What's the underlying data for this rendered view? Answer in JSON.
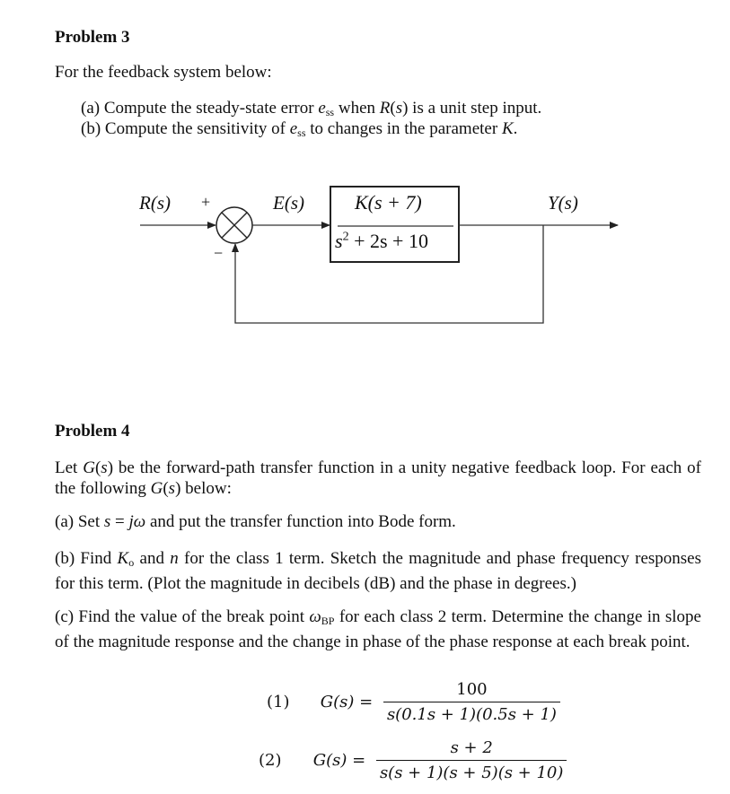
{
  "problem3": {
    "heading": "Problem 3",
    "intro": "For the feedback system below:",
    "parts": [
      {
        "label": "(a)",
        "pre": "Compute the steady-state error ",
        "var": "e",
        "sub": "ss",
        "mid": " when ",
        "var2": "R",
        "post2": "(",
        "var3": "s",
        "post": ") is a unit step input."
      },
      {
        "label": "(b)",
        "pre": "Compute the sensitivity of ",
        "var": "e",
        "sub": "ss",
        "post": " to changes in the parameter ",
        "var2": "K",
        "end": "."
      }
    ],
    "diagram": {
      "input_label": "R(s)",
      "plus_sign": "+",
      "minus_sign": "−",
      "error_label": "E(s)",
      "output_label": "Y(s)",
      "block": {
        "numerator": "K(s + 7)",
        "denominator_base": "s",
        "denominator_exp": "2",
        "denominator_rest": " + 2s + 10"
      }
    }
  },
  "problem4": {
    "heading": "Problem 4",
    "intro_1": "Let ",
    "intro_G": "G",
    "intro_s": "s",
    "intro_2": ") be the forward-path transfer function in a unity negative feedback loop.  For each of the following ",
    "intro_3": ") below:",
    "part_a_pre": "(a) Set ",
    "part_a_s": "s",
    "part_a_eq": " = ",
    "part_a_jw": "jω",
    "part_a_post": " and put the transfer function into Bode form.",
    "part_b_pre": "(b) Find ",
    "part_b_K": "K",
    "part_b_Ksub": "o",
    "part_b_and": " and ",
    "part_b_n": "n",
    "part_b_post": " for the class 1 term.  Sketch the magnitude and phase frequency responses for this term.  (Plot the magnitude in decibels (dB) and the phase in degrees.)",
    "part_c_pre": "(c) Find the value of the break point ",
    "part_c_w": "ω",
    "part_c_sub": "BP",
    "part_c_post": " for each class 2 term.  Determine the change in slope of the magnitude response and the change in phase of the phase response at each break point.",
    "equations": [
      {
        "label": "(1)",
        "lhs": "G(s) =",
        "numerator": "100",
        "denominator": "s(0.1s + 1)(0.5s + 1)"
      },
      {
        "label": "(2)",
        "lhs": "G(s) =",
        "numerator": "s + 2",
        "denominator": "s(s + 1)(s + 5)(s + 10)"
      }
    ]
  }
}
